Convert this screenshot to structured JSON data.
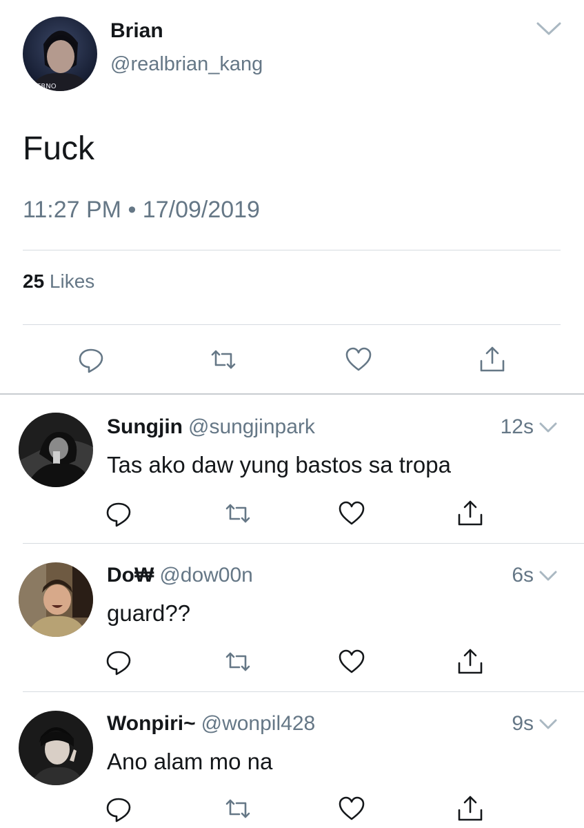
{
  "main_tweet": {
    "name": "Brian",
    "handle": "@realbrian_kang",
    "text": "Fuck",
    "timestamp": "11:27 PM • 17/09/2019",
    "likes_count": "25",
    "likes_label": " Likes",
    "avatar_text": "ERNO"
  },
  "replies": [
    {
      "name": "Sungjin",
      "handle": "@sungjinpark",
      "time": "12s",
      "text": "Tas ako daw yung bastos sa tropa"
    },
    {
      "name": "Do₩",
      "handle": "@dow00n",
      "time": "6s",
      "text": "guard??"
    },
    {
      "name": "Wonpiri~",
      "handle": "@wonpil428",
      "time": "9s",
      "text": "Ano alam mo na"
    }
  ],
  "colors": {
    "text": "#14171a",
    "secondary": "#657786",
    "divider": "#d6dbe0"
  }
}
